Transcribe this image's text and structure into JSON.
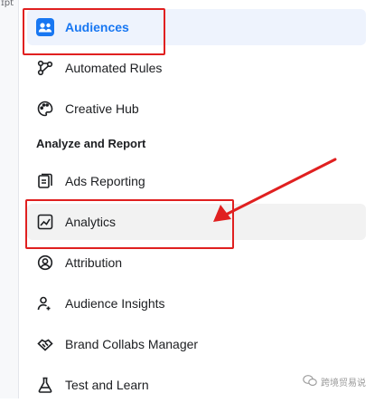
{
  "side_strip": {
    "text": "ɪpt"
  },
  "menu": {
    "items": [
      {
        "label": "Audiences",
        "icon": "people-icon",
        "state": "active"
      },
      {
        "label": "Automated Rules",
        "icon": "automated-rules-icon",
        "state": "normal"
      },
      {
        "label": "Creative Hub",
        "icon": "palette-icon",
        "state": "normal"
      }
    ],
    "section_title": "Analyze and Report",
    "section_items": [
      {
        "label": "Ads Reporting",
        "icon": "ads-reporting-icon",
        "state": "normal"
      },
      {
        "label": "Analytics",
        "icon": "analytics-icon",
        "state": "hover"
      },
      {
        "label": "Attribution",
        "icon": "attribution-icon",
        "state": "normal"
      },
      {
        "label": "Audience Insights",
        "icon": "audience-insights-icon",
        "state": "normal"
      },
      {
        "label": "Brand Collabs Manager",
        "icon": "handshake-icon",
        "state": "normal"
      },
      {
        "label": "Test and Learn",
        "icon": "flask-icon",
        "state": "normal"
      }
    ]
  },
  "annotations": {
    "highlight_color": "#e02020",
    "highlighted_items": [
      "Audiences",
      "Analytics"
    ]
  },
  "watermark": {
    "text": "跨境贸易说"
  },
  "colors": {
    "accent": "#1877f2",
    "active_bg": "#eef3fd",
    "hover_bg": "#f2f2f2"
  }
}
